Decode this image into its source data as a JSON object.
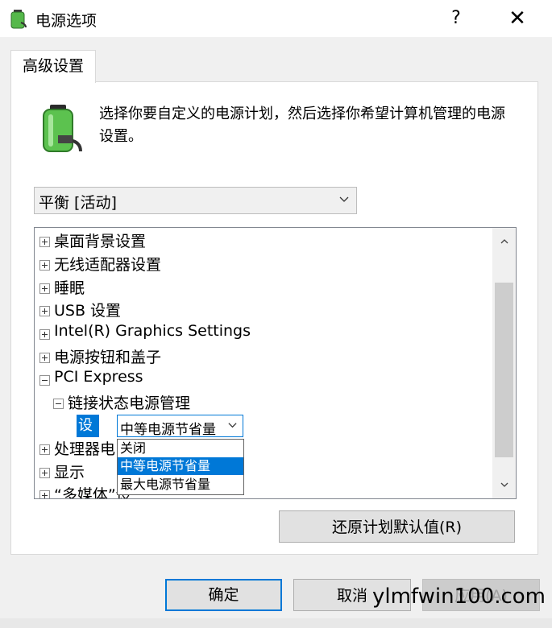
{
  "window": {
    "title": "电源选项",
    "help_glyph": "?",
    "close_glyph": "✕",
    "icon": "power-options-icon"
  },
  "tabs": [
    {
      "label": "高级设置",
      "selected": true
    }
  ],
  "description": "选择你要自定义的电源计划，然后选择你希望计算机管理的电源设置。",
  "plan_select": {
    "value": "平衡 [活动]"
  },
  "tree": {
    "items": [
      {
        "label": "桌面背景设置",
        "expanded": false
      },
      {
        "label": "无线适配器设置",
        "expanded": false
      },
      {
        "label": "睡眠",
        "expanded": false
      },
      {
        "label": "USB 设置",
        "expanded": false
      },
      {
        "label": "Intel(R) Graphics Settings",
        "expanded": false
      },
      {
        "label": "电源按钮和盖子",
        "expanded": false
      },
      {
        "label": "PCI Express",
        "expanded": true
      },
      {
        "label": "链接状态电源管理",
        "expanded": true
      },
      {
        "label": "处理器电",
        "expanded": false
      },
      {
        "label": "显示",
        "expanded": false
      },
      {
        "label": "“多媒体”设",
        "expanded": false
      }
    ],
    "setting": {
      "label": "设置:",
      "value": "中等电源节省量"
    }
  },
  "dropdown": {
    "options": [
      "关闭",
      "中等电源节省量",
      "最大电源节省量"
    ],
    "selected": "中等电源节省量"
  },
  "buttons": {
    "restore": "还原计划默认值(R)",
    "ok": "确定",
    "cancel": "取消",
    "apply": "应用(A)"
  },
  "watermark": "ylmfwin100.com",
  "colors": {
    "accent": "#0078d7",
    "panel_bg": "#f0f0f0"
  }
}
